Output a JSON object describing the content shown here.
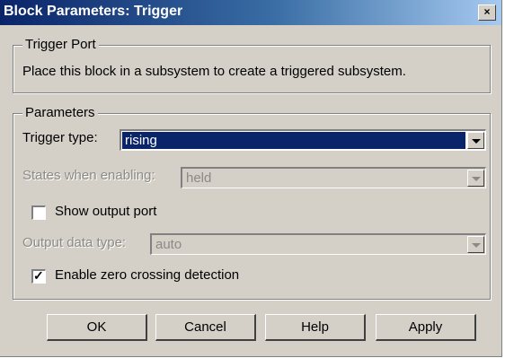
{
  "window": {
    "title": "Block Parameters: Trigger",
    "close_label": "×"
  },
  "trigger_port": {
    "group_label": "Trigger Port",
    "description": "Place this block in a subsystem to create a triggered subsystem."
  },
  "parameters": {
    "group_label": "Parameters",
    "trigger_type_label": "Trigger type:",
    "trigger_type_value": "rising",
    "states_label": "States when enabling:",
    "states_value": "held",
    "show_output_label": "Show output port",
    "show_output_checked": false,
    "output_type_label": "Output data type:",
    "output_type_value": "auto",
    "zero_crossing_label": "Enable zero crossing detection",
    "zero_crossing_checked": true,
    "check_mark": "✓"
  },
  "buttons": {
    "ok": "OK",
    "cancel": "Cancel",
    "help": "Help",
    "apply": "Apply"
  }
}
